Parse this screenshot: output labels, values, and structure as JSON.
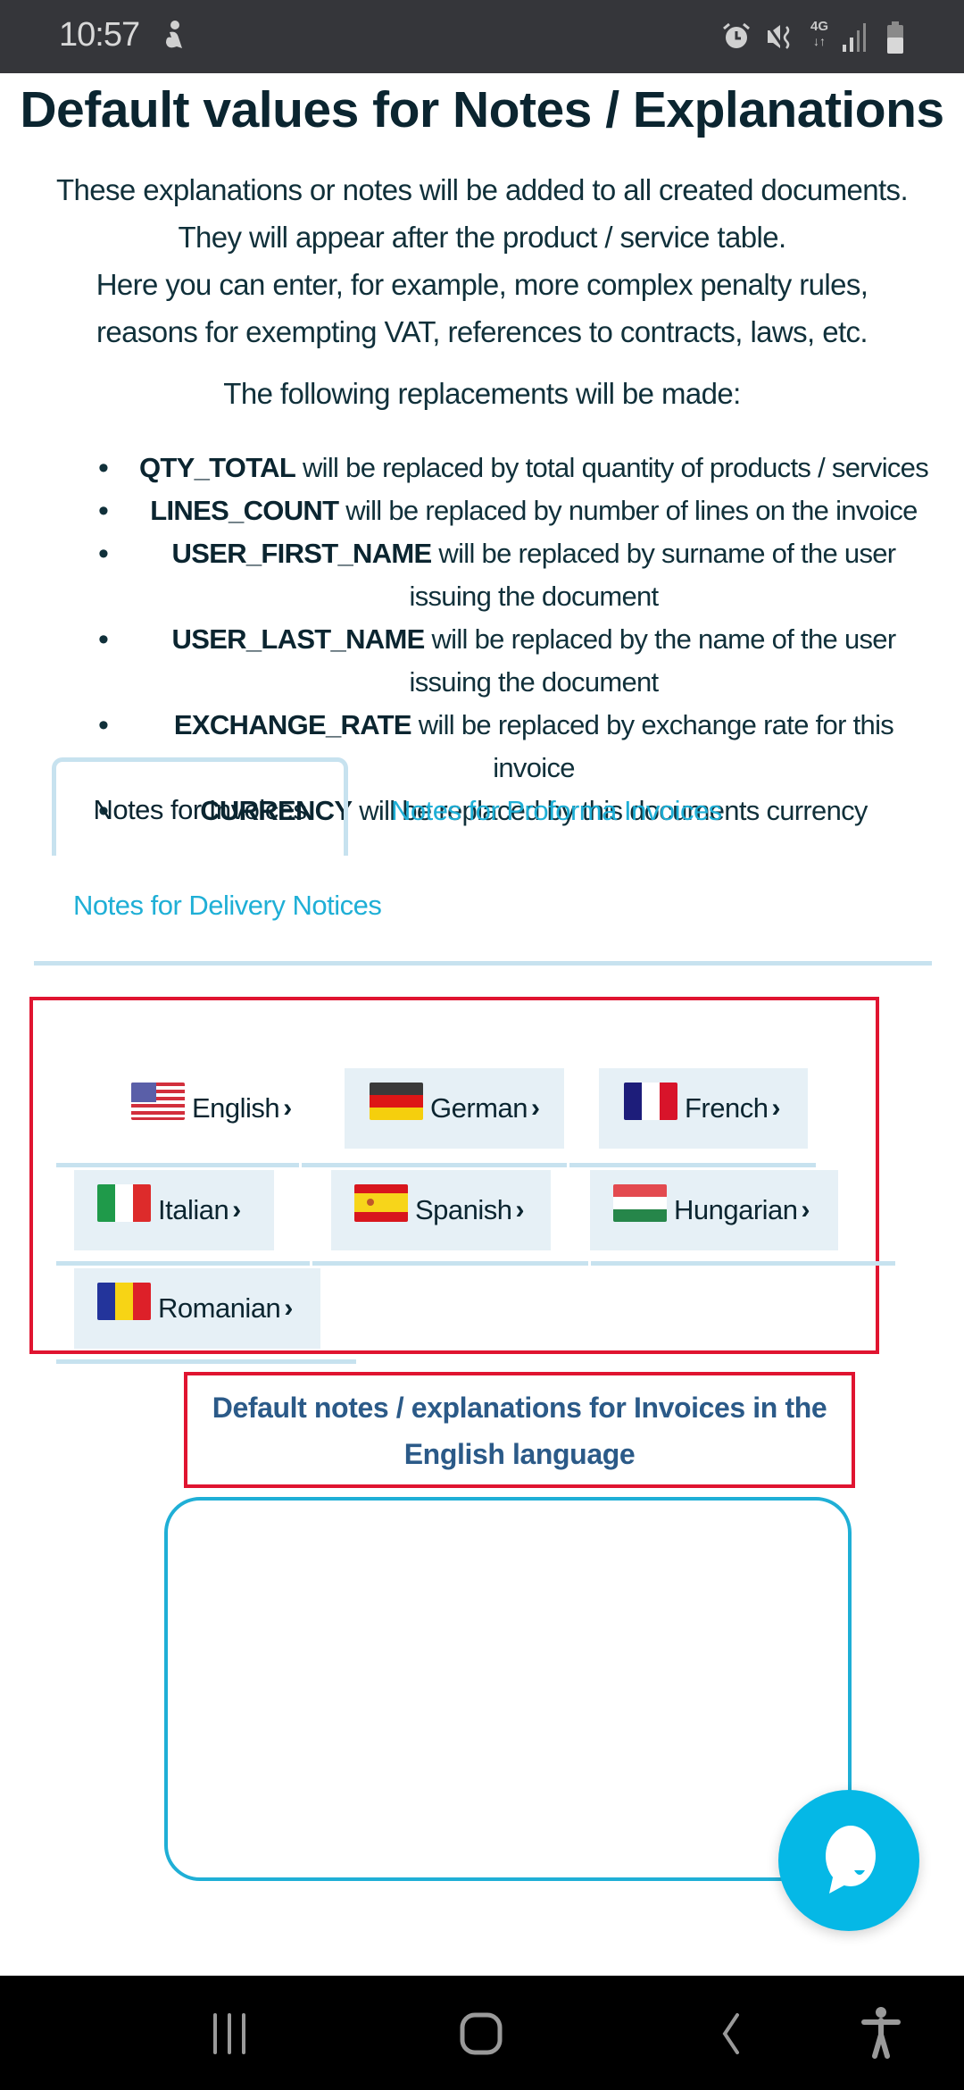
{
  "status_bar": {
    "time": "10:57",
    "network": "4G",
    "icons": [
      "accessibility-notification-icon",
      "alarm-icon",
      "mute-icon",
      "network-4g-icon",
      "signal-icon",
      "battery-icon"
    ]
  },
  "page": {
    "title": "Default values for Notes / Explanations",
    "intro_lines": [
      "These explanations or notes will be added to all created documents.",
      "They will appear after the product / service table.",
      "Here you can enter, for example, more complex penalty rules,",
      "reasons for exempting VAT, references to contracts, laws, etc."
    ],
    "replacements_heading": "The following replacements will be made:",
    "replacements": [
      {
        "key": "QTY_TOTAL",
        "text": " will be replaced by total quantity of products / services"
      },
      {
        "key": "LINES_COUNT",
        "text": " will be replaced by number of lines on the invoice"
      },
      {
        "key": "USER_FIRST_NAME",
        "text": " will be replaced by surname of the user issuing the document"
      },
      {
        "key": "USER_LAST_NAME",
        "text": " will be replaced by the name of the user issuing the document"
      },
      {
        "key": "EXCHANGE_RATE",
        "text": " will be replaced by exchange rate for this invoice"
      },
      {
        "key": "CURRENCY",
        "text": " will be replaced by this documents currency"
      }
    ]
  },
  "tabs": [
    {
      "label": "Notes for Invoices",
      "active": true
    },
    {
      "label": "Notes for Proforma Invoices",
      "active": false
    },
    {
      "label": "Notes for Delivery Notices",
      "active": false
    }
  ],
  "languages": [
    {
      "label": "English",
      "flag": "us-flag-icon",
      "selected": true
    },
    {
      "label": "German",
      "flag": "germany-flag-icon",
      "selected": false
    },
    {
      "label": "French",
      "flag": "france-flag-icon",
      "selected": false
    },
    {
      "label": "Italian",
      "flag": "italy-flag-icon",
      "selected": false
    },
    {
      "label": "Spanish",
      "flag": "spain-flag-icon",
      "selected": false
    },
    {
      "label": "Hungarian",
      "flag": "hungary-flag-icon",
      "selected": false
    },
    {
      "label": "Romanian",
      "flag": "romania-flag-icon",
      "selected": false
    }
  ],
  "chevron": "›",
  "notes_heading": "Default notes / explanations for Invoices in the English language",
  "notes_textarea": {
    "value": "",
    "placeholder": ""
  },
  "colors": {
    "accent": "#1fafd6",
    "highlight_border": "#e01430",
    "heading_blue": "#2b5a88",
    "tab_border": "#c7e2ef",
    "chat_button": "#05b8e6"
  },
  "nav_bar": {
    "buttons": [
      "recent-apps-icon",
      "home-icon",
      "back-icon",
      "accessibility-icon"
    ]
  }
}
